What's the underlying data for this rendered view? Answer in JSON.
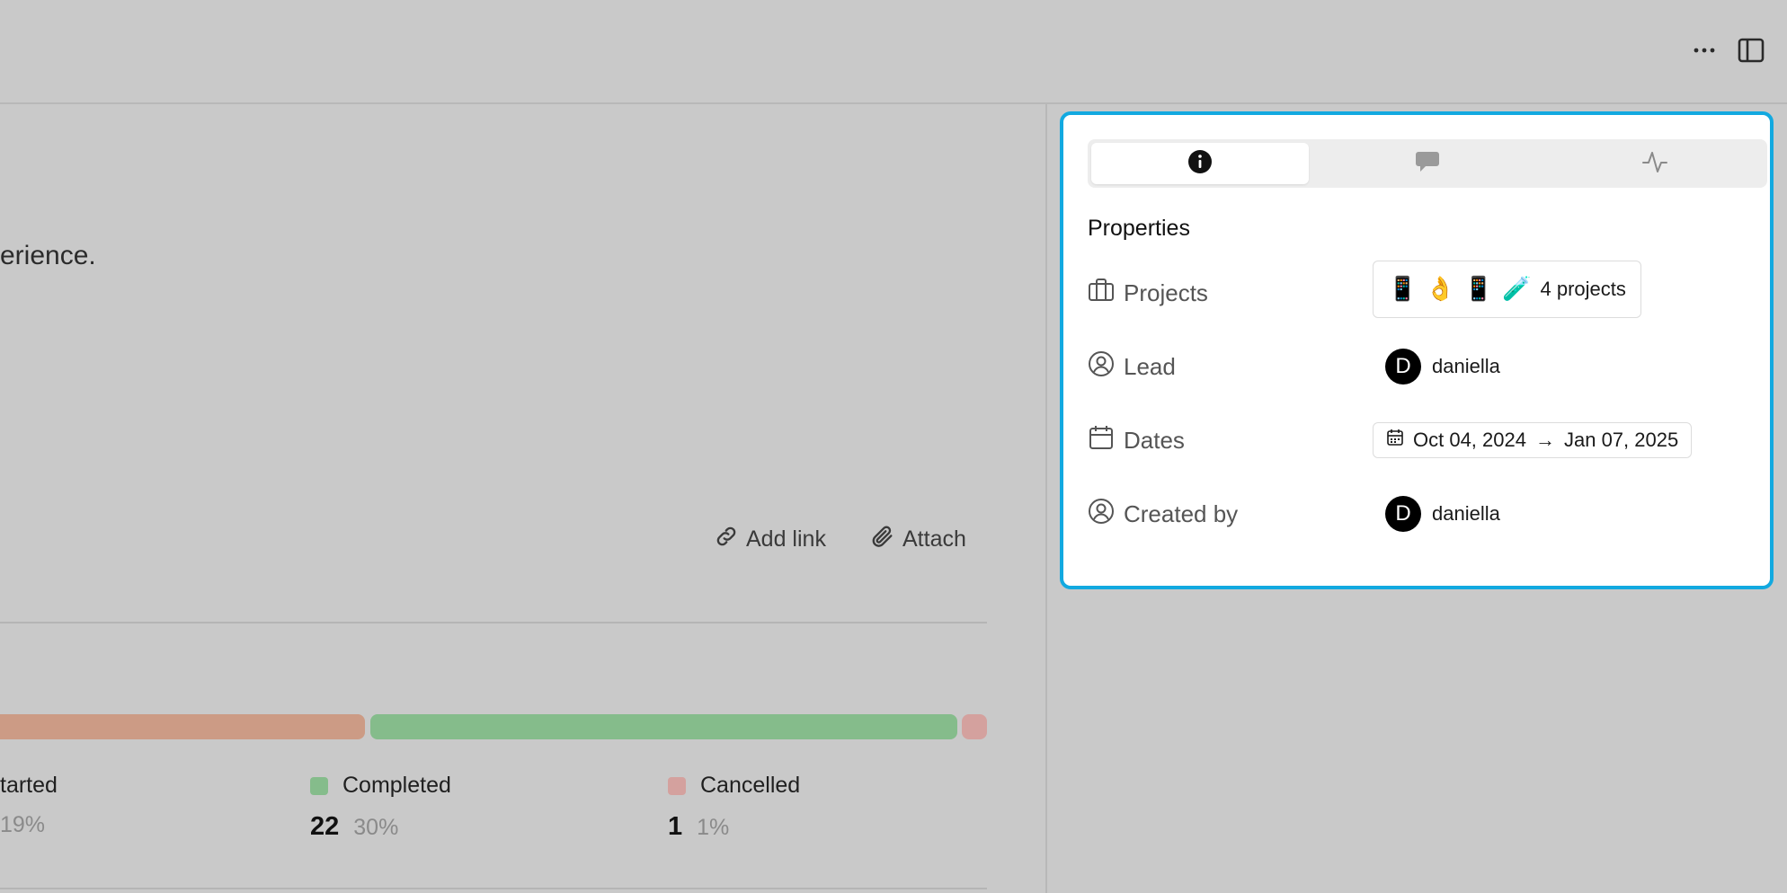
{
  "topbar": {
    "more_icon": "more-horizontal-icon",
    "panel_icon": "sidebar-panel-icon"
  },
  "description": {
    "text_fragment": "erience."
  },
  "actions": {
    "add_link_label": "Add link",
    "attach_label": "Attach"
  },
  "progress": {
    "segments": [
      {
        "name": "Started",
        "color": "#cc9b85"
      },
      {
        "name": "Completed",
        "color": "#85bc8b"
      },
      {
        "name": "Cancelled",
        "color": "#d4a19e"
      }
    ],
    "legend": [
      {
        "name": "tarted",
        "count": "",
        "pct": "19%",
        "color": "#cc9b85"
      },
      {
        "name": "Completed",
        "count": "22",
        "pct": "30%",
        "color": "#85bc8b"
      },
      {
        "name": "Cancelled",
        "count": "1",
        "pct": "1%",
        "color": "#d4a19e"
      }
    ]
  },
  "panel": {
    "accent_color": "#12a9e0",
    "tabs": [
      {
        "icon": "info-icon",
        "active": true
      },
      {
        "icon": "comment-icon",
        "active": false
      },
      {
        "icon": "activity-icon",
        "active": false
      }
    ],
    "section_title": "Properties",
    "properties": {
      "projects": {
        "label": "Projects",
        "emojis": [
          "📱",
          "👌",
          "📱",
          "🧪"
        ],
        "value": "4 projects"
      },
      "lead": {
        "label": "Lead",
        "avatar_initial": "D",
        "value": "daniella"
      },
      "dates": {
        "label": "Dates",
        "start": "Oct 04, 2024",
        "arrow": "→",
        "end": "Jan 07, 2025"
      },
      "created_by": {
        "label": "Created by",
        "avatar_initial": "D",
        "value": "daniella"
      }
    }
  }
}
